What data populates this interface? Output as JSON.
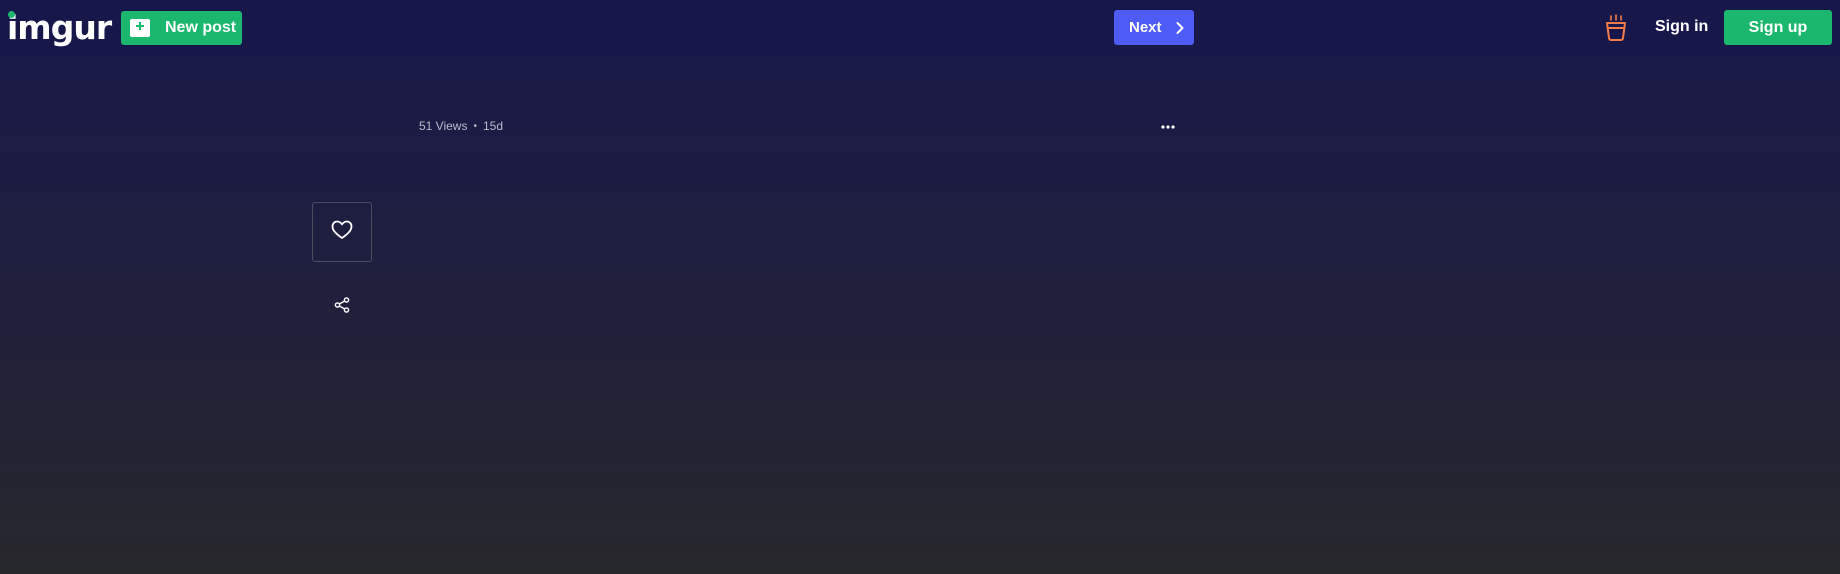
{
  "header": {
    "logo_text": "imgur",
    "new_post_label": "New post",
    "next_label": "Next",
    "sign_in_label": "Sign in",
    "sign_up_label": "Sign up",
    "colors": {
      "bar": "#18174a",
      "green": "#1bb76e",
      "next_blue": "#4e5bf5",
      "bucket_orange": "#f47c4b"
    },
    "icons": [
      "plus-icon",
      "chevron-right-icon",
      "bucket-icon"
    ]
  },
  "post": {
    "views": "51 Views",
    "age": "15d",
    "separator": "•",
    "icons": [
      "more-options-icon",
      "heart-icon",
      "share-icon"
    ]
  }
}
